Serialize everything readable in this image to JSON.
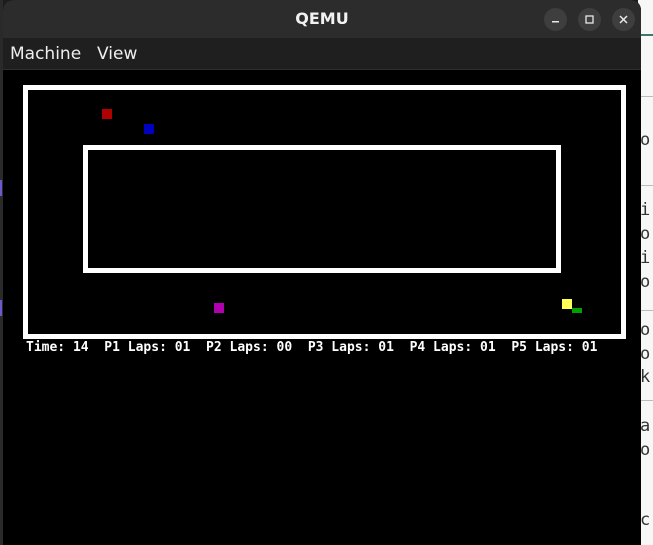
{
  "window": {
    "title": "QEMU"
  },
  "menubar": {
    "items": [
      "Machine",
      "View"
    ]
  },
  "game": {
    "hud": {
      "time_label": "Time:",
      "time_value": "14",
      "players": [
        {
          "label": "P1 Laps:",
          "laps": "01"
        },
        {
          "label": "P2 Laps:",
          "laps": "00"
        },
        {
          "label": "P3 Laps:",
          "laps": "01"
        },
        {
          "label": "P4 Laps:",
          "laps": "01"
        },
        {
          "label": "P5 Laps:",
          "laps": "01"
        }
      ]
    },
    "cars": [
      {
        "player": "P1",
        "color": "#b00000"
      },
      {
        "player": "P2",
        "color": "#0000c0"
      },
      {
        "player": "P3",
        "color": "#b000b0"
      },
      {
        "player": "P4",
        "color": "#ffff55"
      },
      {
        "player": "P5",
        "color": "#00a000"
      }
    ],
    "track_color": "#ffffff",
    "background_color": "#000000"
  },
  "background_window": {
    "text_fragments": [
      "o:",
      "i:",
      "o:",
      "i:",
      "o:",
      "o:",
      "o:",
      "k",
      "a",
      "o:",
      "c"
    ]
  }
}
